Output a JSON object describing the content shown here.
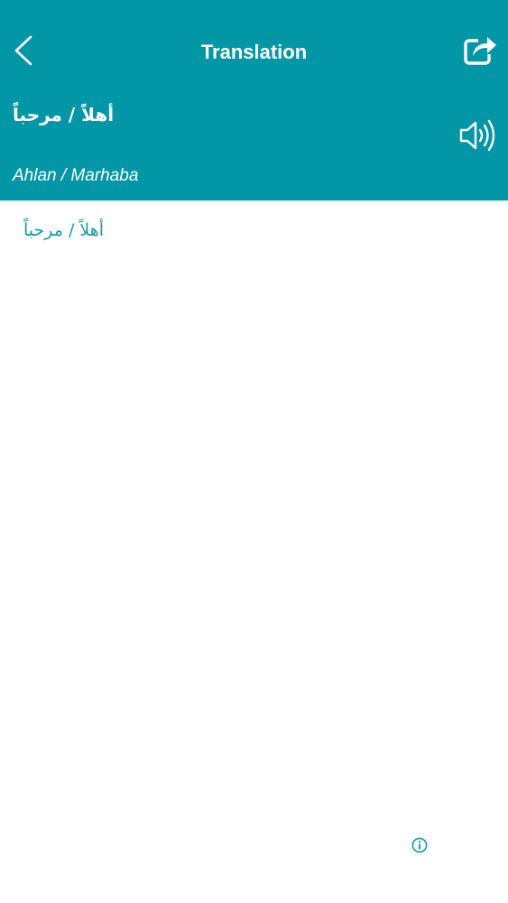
{
  "header": {
    "title": "Translation",
    "back_icon": "chevron-left-icon",
    "share_icon": "share-icon",
    "background_color": "#0396a6"
  },
  "phrase": {
    "arabic": "أهلاً / مرحباً",
    "transliteration": "Ahlan / Marhaba",
    "speaker_icon": "speaker-icon"
  },
  "content": {
    "translation": "أهلاً / مرحباً",
    "text_color": "#1b97a8"
  },
  "footer": {
    "info_icon": "info-icon"
  }
}
